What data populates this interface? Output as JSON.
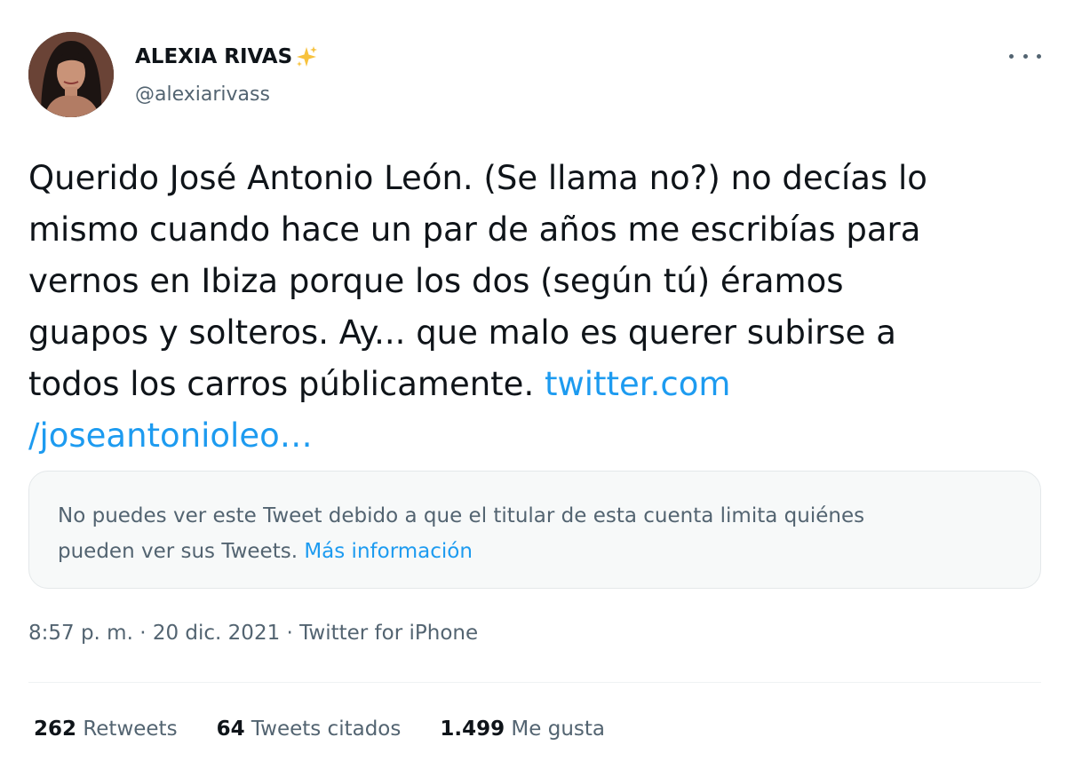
{
  "author": {
    "display_name": "ALEXIA RIVAS",
    "display_emoji_icon": "sparkles-icon",
    "handle": "@alexiarivass",
    "avatar_icon": "avatar"
  },
  "tweet": {
    "lines": [
      "Querido José Antonio León. (Se llama no?) no decías lo",
      "mismo cuando hace un par de años me escribías para",
      "vernos en Ibiza porque los dos (según tú) éramos",
      "guapos y solteros. Ay... que malo es querer subirse a",
      "todos los carros públicamente. "
    ],
    "link_part1": "twitter.com",
    "link_part2": "/joseantonioleo…"
  },
  "notice": {
    "line1": "No puedes ver este Tweet debido a que el titular de esta cuenta limita quiénes",
    "line2_prefix": "pueden ver sus Tweets. ",
    "more_info_link": "Más información"
  },
  "meta": {
    "time": "8:57 p. m.",
    "separator": " · ",
    "date": "20 dic. 2021",
    "source": "Twitter for iPhone"
  },
  "stats": {
    "retweets_count": "262",
    "retweets_label": " Retweets",
    "quotes_count": "64",
    "quotes_label": " Tweets citados",
    "likes_count": "1.499",
    "likes_label": " Me gusta"
  },
  "colors": {
    "text": "#0f1419",
    "secondary": "#536471",
    "link": "#1d9bf0",
    "notice_bg": "#f7f9f9"
  }
}
